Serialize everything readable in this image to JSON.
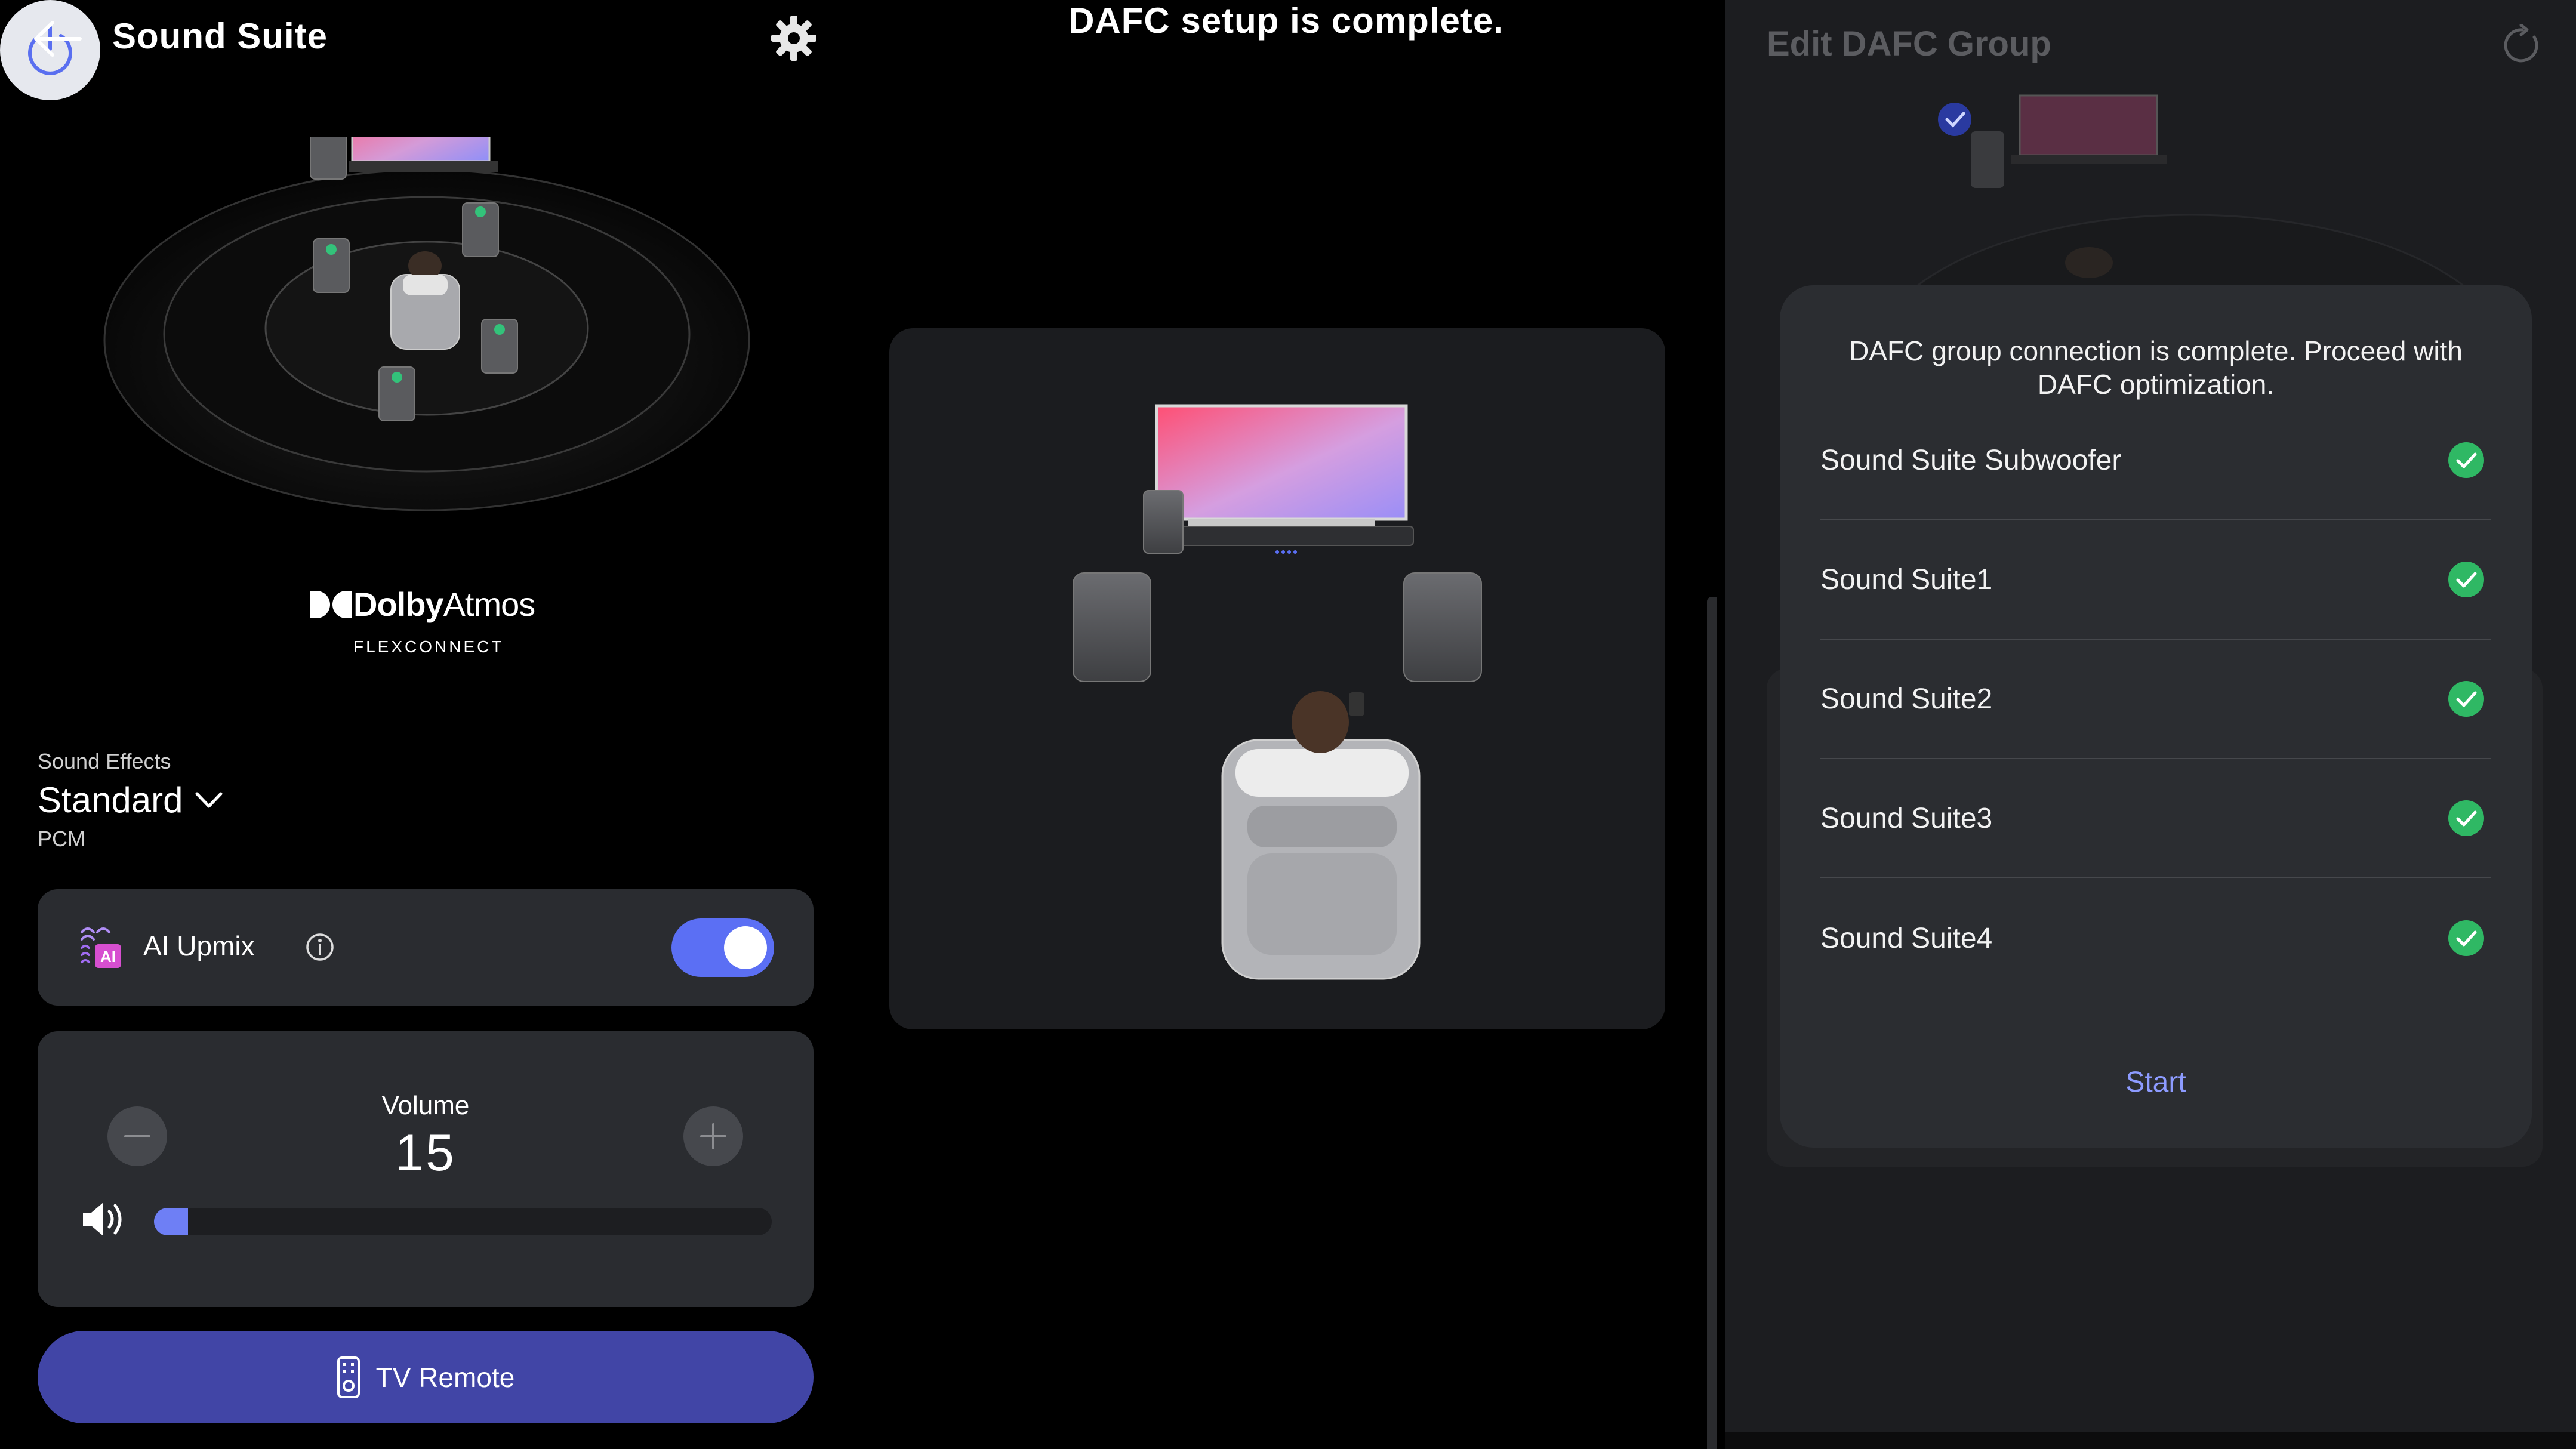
{
  "left_panel": {
    "title": "Sound Suite",
    "icons": {
      "back": "back-arrow-icon",
      "settings": "gear-icon",
      "power": "power-icon"
    },
    "brand": {
      "dolby_name_bold": "Dolby",
      "dolby_name_light": "Atmos",
      "dolby_subtitle": "FLEXCONNECT"
    },
    "sound_effects": {
      "label": "Sound Effects",
      "value": "Standard",
      "format": "PCM"
    },
    "ai_upmix": {
      "label": "AI Upmix",
      "icon_text": "AI",
      "enabled": true
    },
    "volume": {
      "label": "Volume",
      "value": "15",
      "level_percent": 5.5
    },
    "tv_remote": {
      "label": "TV Remote"
    }
  },
  "middle_panel": {
    "title": "DAFC setup is complete."
  },
  "right_panel": {
    "title": "Edit DAFC Group",
    "dialog": {
      "message": "DAFC group connection is complete. Proceed with DAFC optimization.",
      "devices": [
        {
          "name": "Sound Suite Subwoofer",
          "status": "connected"
        },
        {
          "name": "Sound Suite1",
          "status": "connected"
        },
        {
          "name": "Sound Suite2",
          "status": "connected"
        },
        {
          "name": "Sound Suite3",
          "status": "connected"
        },
        {
          "name": "Sound Suite4",
          "status": "connected"
        }
      ],
      "action_label": "Start"
    }
  },
  "colors": {
    "accent": "#5b6ff4",
    "remote_button": "#4145a6",
    "check_green": "#2fb864",
    "start_link": "#8d9bff",
    "card_bg": "#2a2c30"
  }
}
